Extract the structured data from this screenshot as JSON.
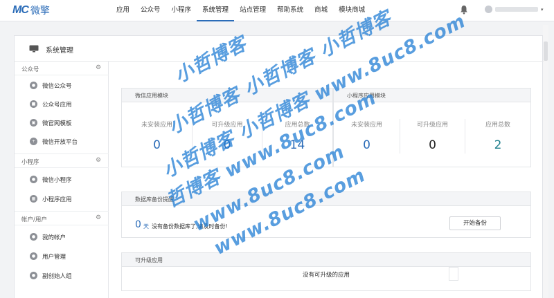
{
  "brand": {
    "logo_mark": "MC",
    "logo_text": "微擎"
  },
  "nav": {
    "items": [
      {
        "label": "应用"
      },
      {
        "label": "公众号"
      },
      {
        "label": "小程序"
      },
      {
        "label": "系统管理",
        "active": true
      },
      {
        "label": "站点管理"
      },
      {
        "label": "帮助系统"
      },
      {
        "label": "商城"
      },
      {
        "label": "模块商城"
      }
    ],
    "icons": {
      "bell": "bell-icon",
      "caret": "▾"
    }
  },
  "page": {
    "title": "系统管理",
    "title_icon": "monitor-icon"
  },
  "sidebar": {
    "groups": [
      {
        "title": "公众号",
        "items": [
          {
            "label": "微信公众号",
            "icon": "wechat-icon"
          },
          {
            "label": "公众号应用",
            "icon": "bag-icon"
          },
          {
            "label": "微官网模板",
            "icon": "template-icon"
          },
          {
            "label": "微信开放平台",
            "icon": "platform-icon"
          }
        ]
      },
      {
        "title": "小程序",
        "items": [
          {
            "label": "微信小程序",
            "icon": "miniprogram-icon"
          },
          {
            "label": "小程序应用",
            "icon": "miniapp-icon"
          }
        ]
      },
      {
        "title": "帐户/用户",
        "items": [
          {
            "label": "我的帐户",
            "icon": "user-icon"
          },
          {
            "label": "用户管理",
            "icon": "users-icon"
          },
          {
            "label": "副创始人组",
            "icon": "founder-icon"
          }
        ]
      }
    ]
  },
  "wechat_module": {
    "title": "微信应用模块",
    "stats": [
      {
        "label": "未安装应用",
        "value": "0"
      },
      {
        "label": "可升级应用",
        "value": "0"
      },
      {
        "label": "应用总数",
        "value": "14"
      }
    ]
  },
  "mini_module": {
    "title": "小程序应用模块",
    "stats": [
      {
        "label": "未安装应用",
        "value": "0"
      },
      {
        "label": "可升级应用",
        "value": "0"
      },
      {
        "label": "应用总数",
        "value": "2"
      }
    ]
  },
  "backup": {
    "title": "数据库备份提醒",
    "count": "0",
    "unit": "天",
    "message": "没有备份数据库了,请及时备份!",
    "button": "开始备份"
  },
  "upgradable": {
    "title": "可升级应用",
    "empty": "没有可升级的应用"
  },
  "watermark": {
    "lines": [
      "小哲博客",
      "小哲博客 小哲博客 小哲博客",
      "小哲博客 小哲博客 www.8uc8.com",
      "哲博客 www.8uc8.com",
      "www.8uc8.com",
      "www.8uc8.com"
    ]
  }
}
